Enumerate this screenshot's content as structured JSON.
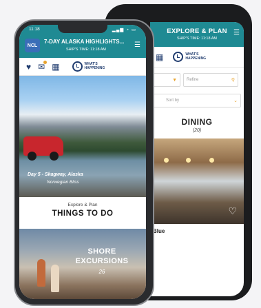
{
  "back_screen": {
    "title": "EXPLORE & PLAN",
    "ships_time": "SHIP'S TIME: 11:18 AM",
    "whats_happening": [
      "WHAT'S",
      "HAPPENING"
    ],
    "filter_placeholder": "Refine",
    "sort_label": "Sort by",
    "section_title": "DINING",
    "section_count": "(20)",
    "venue_partial": "Blue"
  },
  "front_screen": {
    "status_time": "11:18",
    "logo": "NCL",
    "title": "7-DAY ALASKA HIGHLIGHTS...",
    "ships_time": "SHIP'S TIME: 11:18 AM",
    "whats_happening": [
      "WHAT'S",
      "HAPPENING"
    ],
    "hero": {
      "day_label": "Day 5 - Skagway, Alaska",
      "ship_name": "Norwegian Bliss"
    },
    "things_to_do": {
      "kicker": "Explore & Plan",
      "title": "THINGS TO DO"
    },
    "shore": {
      "title_line1": "SHORE",
      "title_line2": "EXCURSIONS",
      "count": "26"
    }
  },
  "icons": {
    "heart": "heart-icon",
    "chat": "chat-icon",
    "calendar": "calendar-icon",
    "clock": "clock-icon",
    "menu": "hamburger-menu-icon"
  },
  "colors": {
    "header_teal": "#1f8a93",
    "accent_gold": "#e8a32c",
    "navy": "#1f3b6e",
    "ncl_blue": "#3a6eb8",
    "jeep_red": "#c8262d"
  }
}
